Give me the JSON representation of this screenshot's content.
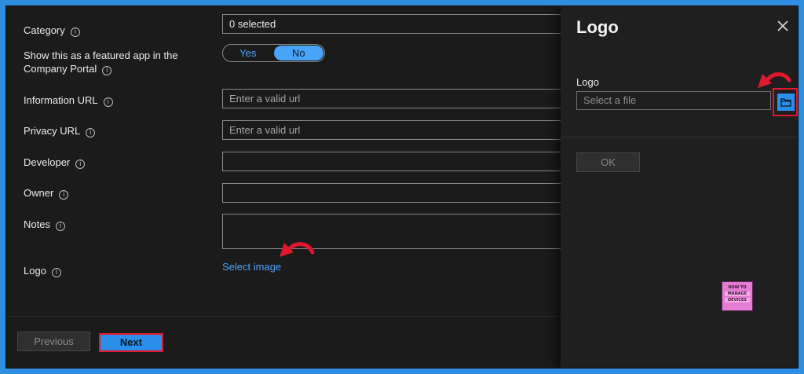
{
  "form": {
    "category": {
      "label": "Category",
      "value": "0 selected"
    },
    "featured": {
      "label": "Show this as a featured app in the Company Portal",
      "options": [
        "Yes",
        "No"
      ],
      "selected": "No"
    },
    "information_url": {
      "label": "Information URL",
      "placeholder": "Enter a valid url"
    },
    "privacy_url": {
      "label": "Privacy URL",
      "placeholder": "Enter a valid url"
    },
    "developer": {
      "label": "Developer",
      "value": ""
    },
    "owner": {
      "label": "Owner",
      "value": ""
    },
    "notes": {
      "label": "Notes",
      "value": ""
    },
    "logo": {
      "label": "Logo",
      "link": "Select image"
    }
  },
  "footer": {
    "previous_label": "Previous",
    "next_label": "Next"
  },
  "panel": {
    "title": "Logo",
    "field_label": "Logo",
    "file_placeholder": "Select a file",
    "ok_label": "OK",
    "brand_logo": [
      "HOW TO",
      "MANAGE",
      "DEVICES"
    ]
  },
  "colors": {
    "accent": "#2b8ee8",
    "highlight": "#e0182d",
    "link": "#4fa3ff",
    "frame": "#2f8ee0"
  },
  "icons": {
    "info": "info-icon",
    "close": "close-icon",
    "browse": "folder-icon",
    "arrow": "red-curved-arrow-icon"
  }
}
